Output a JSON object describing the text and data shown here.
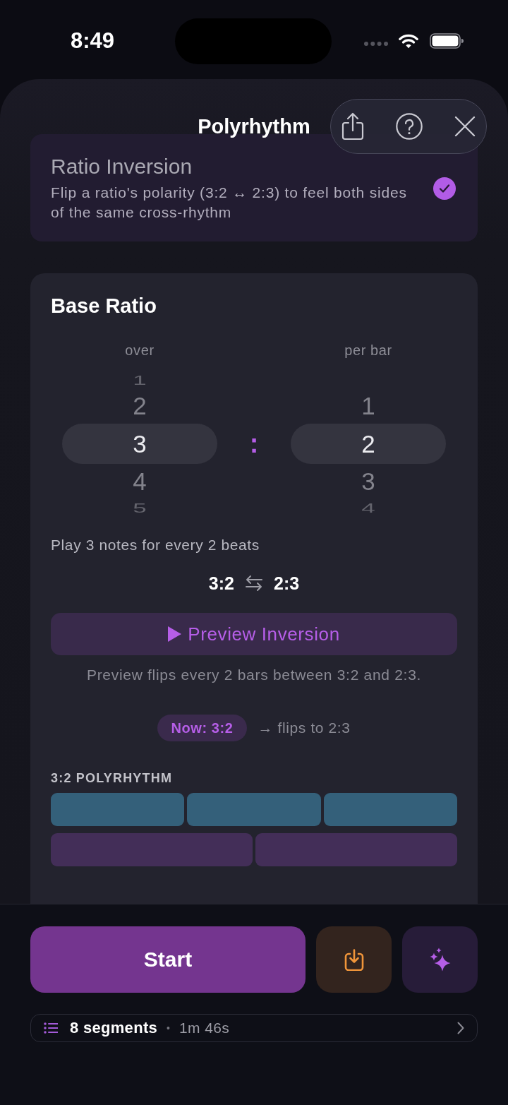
{
  "status_bar": {
    "time": "8:49"
  },
  "nav": {
    "title": "Polyrhythm",
    "actions": [
      {
        "kind": "share"
      },
      {
        "kind": "help"
      },
      {
        "kind": "close"
      }
    ]
  },
  "feature_card": {
    "title": "Ratio Inversion",
    "description": "Flip a ratio's polarity (3:2 ↔ 2:3) to feel both sides of the same cross-rhythm",
    "checked": true
  },
  "base_ratio": {
    "title": "Base Ratio",
    "pickers": [
      {
        "label": "over",
        "items": [
          {
            "value": "1",
            "selected": false
          },
          {
            "value": "2",
            "selected": false
          },
          {
            "value": "3",
            "selected": true
          },
          {
            "value": "4",
            "selected": false
          },
          {
            "value": "5",
            "selected": false
          }
        ]
      },
      {
        "label": "per bar",
        "items": [
          {
            "value": "1",
            "selected": false
          },
          {
            "value": "2",
            "selected": true
          },
          {
            "value": "3",
            "selected": false
          },
          {
            "value": "4",
            "selected": false
          }
        ]
      }
    ],
    "separator": ":",
    "summary": "Play 3 notes for every 2 beats",
    "inversion": {
      "from": "3:2",
      "to": "2:3"
    },
    "preview_button": "Preview Inversion",
    "preview_note": "Preview flips every 2 bars between 3:2 and 2:3.",
    "status": {
      "current": "Now: 3:2",
      "next": "→ flips to 2:3"
    },
    "visual": {
      "title": "3:2 POLYRHYTHM",
      "lanes": [
        {
          "blocks": [
            {
              "color": "#34607a"
            },
            {
              "color": "#34607a"
            },
            {
              "color": "#34607a"
            }
          ]
        },
        {
          "blocks": [
            {
              "color": "#432e58"
            },
            {
              "color": "#432e58"
            }
          ]
        }
      ]
    }
  },
  "bottom_bar": {
    "start_button": "Start",
    "tools": [
      {
        "kind": "import"
      },
      {
        "kind": "sparkle"
      }
    ],
    "segments": {
      "count": "8 segments",
      "separator": "•",
      "duration": "1m 46s"
    }
  }
}
